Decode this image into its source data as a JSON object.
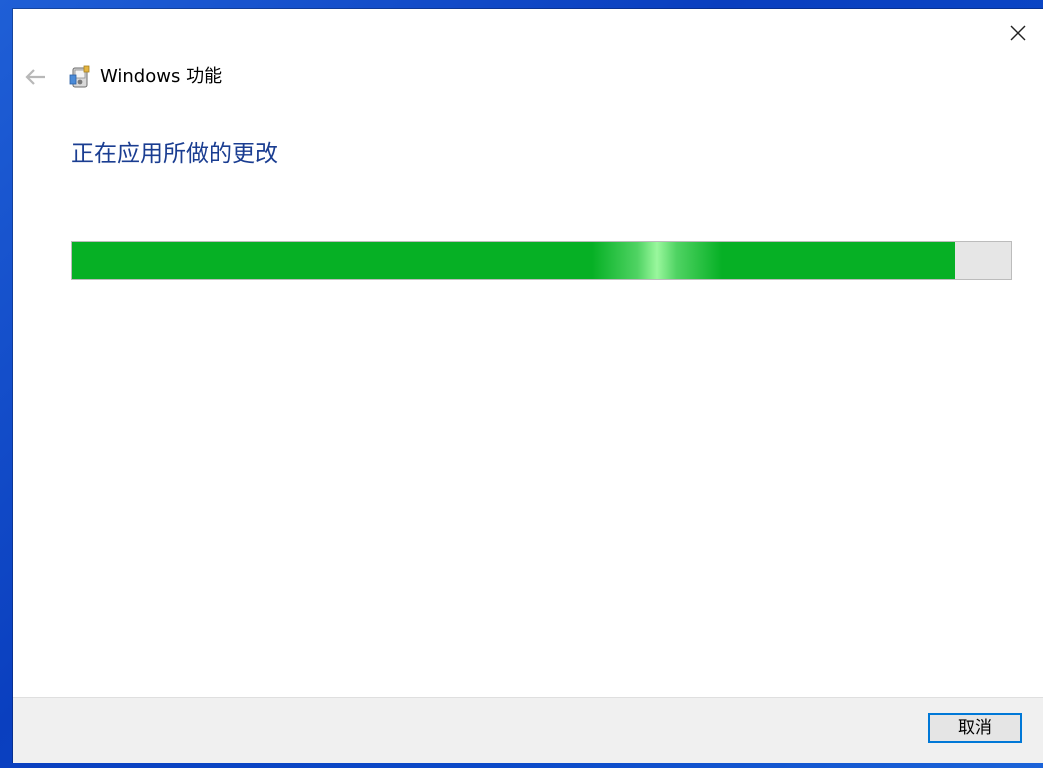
{
  "window": {
    "app_title": "Windows 功能",
    "heading": "正在应用所做的更改"
  },
  "progress": {
    "value_percent": 94,
    "color": "#06b025",
    "track_color": "#e6e6e6"
  },
  "footer": {
    "cancel_label": "取消"
  },
  "colors": {
    "heading": "#1a3d91",
    "button_border": "#0078d7"
  },
  "icons": [
    "close-icon",
    "back-arrow-icon",
    "windows-features-icon"
  ]
}
